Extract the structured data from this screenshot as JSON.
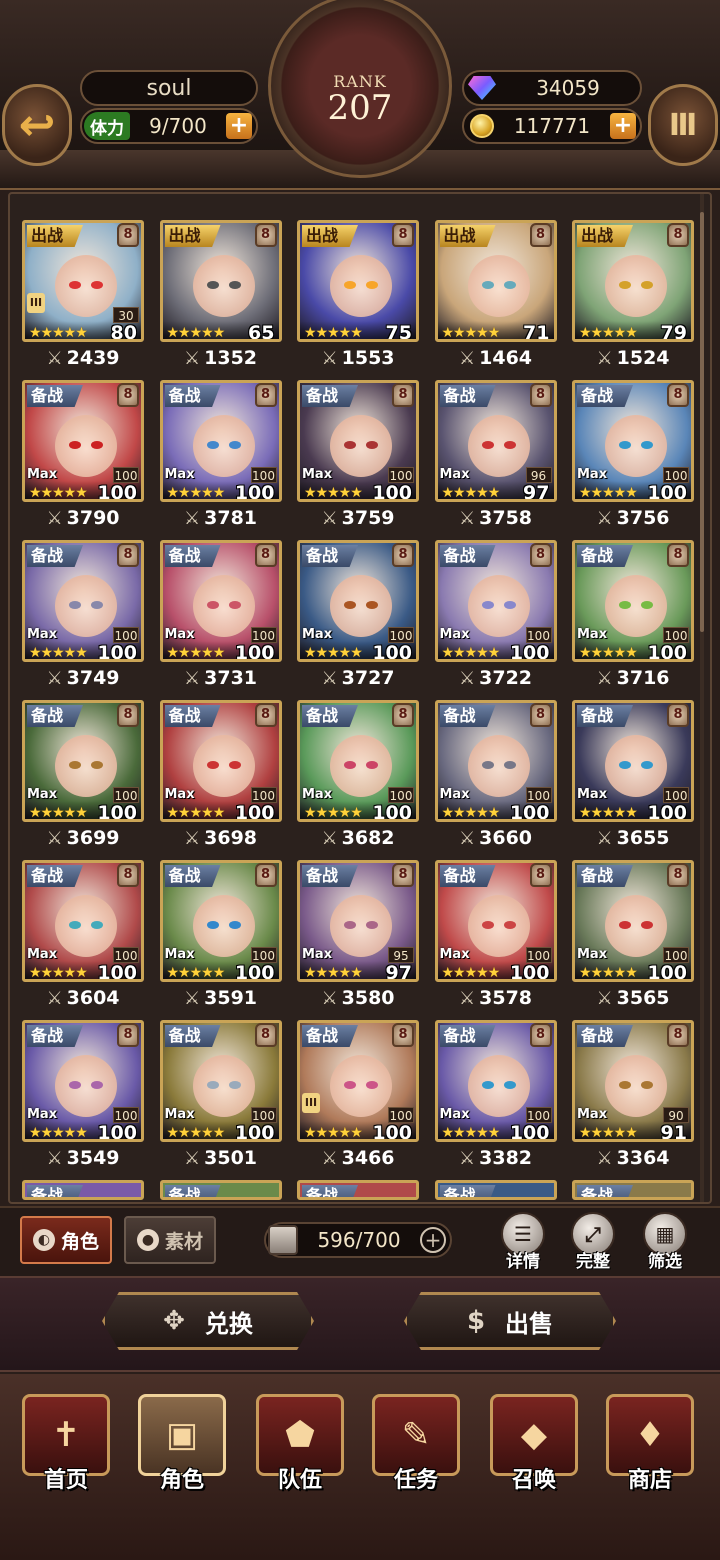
{
  "header": {
    "player_name": "soul",
    "stamina_label": "体力",
    "stamina_value": "9/700",
    "rank_label": "RANK",
    "rank_value": "207",
    "gems": "34059",
    "gold": "117771",
    "plus": "+"
  },
  "cards": [
    {
      "status": "出战",
      "level": "80",
      "limit": "30",
      "tier": "III",
      "power": "2439",
      "max": "",
      "bg": "#8fb0c8",
      "eye": "#d33"
    },
    {
      "status": "出战",
      "level": "65",
      "limit": "",
      "tier": "",
      "power": "1352",
      "max": "",
      "bg": "#6e6e78",
      "eye": "#555"
    },
    {
      "status": "出战",
      "level": "75",
      "limit": "",
      "tier": "",
      "power": "1553",
      "max": "",
      "bg": "#4a4aa8",
      "eye": "#f7a52a"
    },
    {
      "status": "出战",
      "level": "71",
      "limit": "",
      "tier": "",
      "power": "1464",
      "max": "",
      "bg": "#c9a67a",
      "eye": "#6ab"
    },
    {
      "status": "出战",
      "level": "79",
      "limit": "",
      "tier": "",
      "power": "1524",
      "max": "",
      "bg": "#7fa476",
      "eye": "#d4a12a"
    },
    {
      "status": "备战",
      "level": "100",
      "limit": "100",
      "tier": "",
      "power": "3790",
      "max": "Max",
      "bg": "#c14848",
      "eye": "#c22"
    },
    {
      "status": "备战",
      "level": "100",
      "limit": "100",
      "tier": "",
      "power": "3781",
      "max": "Max",
      "bg": "#7a6cb8",
      "eye": "#48c"
    },
    {
      "status": "备战",
      "level": "100",
      "limit": "100",
      "tier": "",
      "power": "3759",
      "max": "Max",
      "bg": "#4a3a50",
      "eye": "#a33"
    },
    {
      "status": "备战",
      "level": "97",
      "limit": "96",
      "tier": "",
      "power": "3758",
      "max": "Max",
      "bg": "#5a5470",
      "eye": "#c33"
    },
    {
      "status": "备战",
      "level": "100",
      "limit": "100",
      "tier": "",
      "power": "3756",
      "max": "Max",
      "bg": "#5a86b8",
      "eye": "#39c"
    },
    {
      "status": "备战",
      "level": "100",
      "limit": "100",
      "tier": "",
      "power": "3749",
      "max": "Max",
      "bg": "#7a6aa8",
      "eye": "#88a"
    },
    {
      "status": "备战",
      "level": "100",
      "limit": "100",
      "tier": "",
      "power": "3731",
      "max": "Max",
      "bg": "#b8506a",
      "eye": "#c56"
    },
    {
      "status": "备战",
      "level": "100",
      "limit": "100",
      "tier": "",
      "power": "3727",
      "max": "Max",
      "bg": "#3a5a86",
      "eye": "#a52"
    },
    {
      "status": "备战",
      "level": "100",
      "limit": "100",
      "tier": "",
      "power": "3722",
      "max": "Max",
      "bg": "#8a7ab0",
      "eye": "#88c"
    },
    {
      "status": "备战",
      "level": "100",
      "limit": "100",
      "tier": "",
      "power": "3716",
      "max": "Max",
      "bg": "#6a9a5a",
      "eye": "#7b4"
    },
    {
      "status": "备战",
      "level": "100",
      "limit": "100",
      "tier": "",
      "power": "3699",
      "max": "Max",
      "bg": "#4a6a3a",
      "eye": "#a73"
    },
    {
      "status": "备战",
      "level": "100",
      "limit": "100",
      "tier": "",
      "power": "3698",
      "max": "Max",
      "bg": "#b04040",
      "eye": "#c33"
    },
    {
      "status": "备战",
      "level": "100",
      "limit": "100",
      "tier": "",
      "power": "3682",
      "max": "Max",
      "bg": "#5a9a5a",
      "eye": "#c46"
    },
    {
      "status": "备战",
      "level": "100",
      "limit": "100",
      "tier": "",
      "power": "3660",
      "max": "Max",
      "bg": "#6a6a80",
      "eye": "#778"
    },
    {
      "status": "备战",
      "level": "100",
      "limit": "100",
      "tier": "",
      "power": "3655",
      "max": "Max",
      "bg": "#3a3a5a",
      "eye": "#39c"
    },
    {
      "status": "备战",
      "level": "100",
      "limit": "100",
      "tier": "",
      "power": "3604",
      "max": "Max",
      "bg": "#b04a4a",
      "eye": "#4ab"
    },
    {
      "status": "备战",
      "level": "100",
      "limit": "100",
      "tier": "",
      "power": "3591",
      "max": "Max",
      "bg": "#6a8a4a",
      "eye": "#38c"
    },
    {
      "status": "备战",
      "level": "97",
      "limit": "95",
      "tier": "",
      "power": "3580",
      "max": "Max",
      "bg": "#7a5a8a",
      "eye": "#a68"
    },
    {
      "status": "备战",
      "level": "100",
      "limit": "100",
      "tier": "",
      "power": "3578",
      "max": "Max",
      "bg": "#c04a4a",
      "eye": "#c44"
    },
    {
      "status": "备战",
      "level": "100",
      "limit": "100",
      "tier": "",
      "power": "3565",
      "max": "Max",
      "bg": "#6a7a5a",
      "eye": "#c33"
    },
    {
      "status": "备战",
      "level": "100",
      "limit": "100",
      "tier": "",
      "power": "3549",
      "max": "Max",
      "bg": "#6a5aa8",
      "eye": "#a6a"
    },
    {
      "status": "备战",
      "level": "100",
      "limit": "100",
      "tier": "",
      "power": "3501",
      "max": "Max",
      "bg": "#8a7a3a",
      "eye": "#9ab"
    },
    {
      "status": "备战",
      "level": "100",
      "limit": "100",
      "tier": "III",
      "power": "3466",
      "max": "",
      "bg": "#b07a5a",
      "eye": "#c58"
    },
    {
      "status": "备战",
      "level": "100",
      "limit": "100",
      "tier": "",
      "power": "3382",
      "max": "Max",
      "bg": "#6a5aa8",
      "eye": "#39c"
    },
    {
      "status": "备战",
      "level": "91",
      "limit": "90",
      "tier": "",
      "power": "3364",
      "max": "Max",
      "bg": "#8a7a4a",
      "eye": "#a73"
    }
  ],
  "partial_cards": [
    {
      "status": "备战",
      "bg": "#7a5aa8"
    },
    {
      "status": "备战",
      "bg": "#6a8a4a"
    },
    {
      "status": "备战",
      "bg": "#b04a4a"
    },
    {
      "status": "备战",
      "bg": "#3a5a86"
    },
    {
      "status": "备战",
      "bg": "#8a7a4a"
    }
  ],
  "toolbar": {
    "tab_role": "角色",
    "tab_material": "素材",
    "capacity": "596/700",
    "details": "详情",
    "complete": "完整",
    "filter": "筛选"
  },
  "actions": {
    "exchange": "兑换",
    "sell": "出售"
  },
  "nav": {
    "home": "首页",
    "role": "角色",
    "team": "队伍",
    "quest": "任务",
    "summon": "召唤",
    "shop": "商店"
  }
}
